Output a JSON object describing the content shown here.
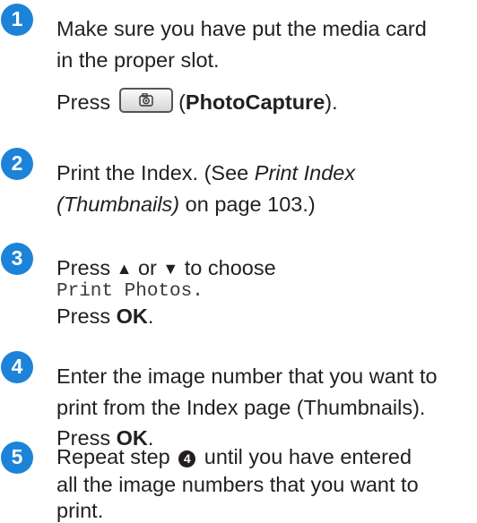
{
  "steps": [
    {
      "number": "1",
      "line1": "Make sure you have put the media card",
      "line2": "in the proper slot.",
      "press_word": "Press",
      "button_icon": "camera-icon",
      "open_paren": "(",
      "button_label": "PhotoCapture",
      "close_paren": ")."
    },
    {
      "number": "2",
      "l1_text": "Print the Index. (See ",
      "l1_italic": "Print Index",
      "l2_italic": "(Thumbnails)",
      "l2_text": " on page 103.)"
    },
    {
      "number": "3",
      "l1_a": "Press ",
      "up_symbol": "▲",
      "l1_b": " or ",
      "down_symbol": "▼",
      "l1_c": " to choose",
      "menu_option": "Print Photos.",
      "press_word": "Press ",
      "ok_key": "OK",
      "period": "."
    },
    {
      "number": "4",
      "line1": "Enter the image number that you want to",
      "line2": "print from the Index page (Thumbnails).",
      "press_word": "Press ",
      "ok_key": "OK",
      "period": "."
    },
    {
      "number": "5",
      "l1_a": "Repeat step ",
      "step_ref": "4",
      "l1_b": " until you have entered",
      "line2": "all the image numbers that you want to",
      "line3": "print."
    }
  ],
  "colors": {
    "step_badge": "#1c83d8",
    "text": "#231f20"
  }
}
